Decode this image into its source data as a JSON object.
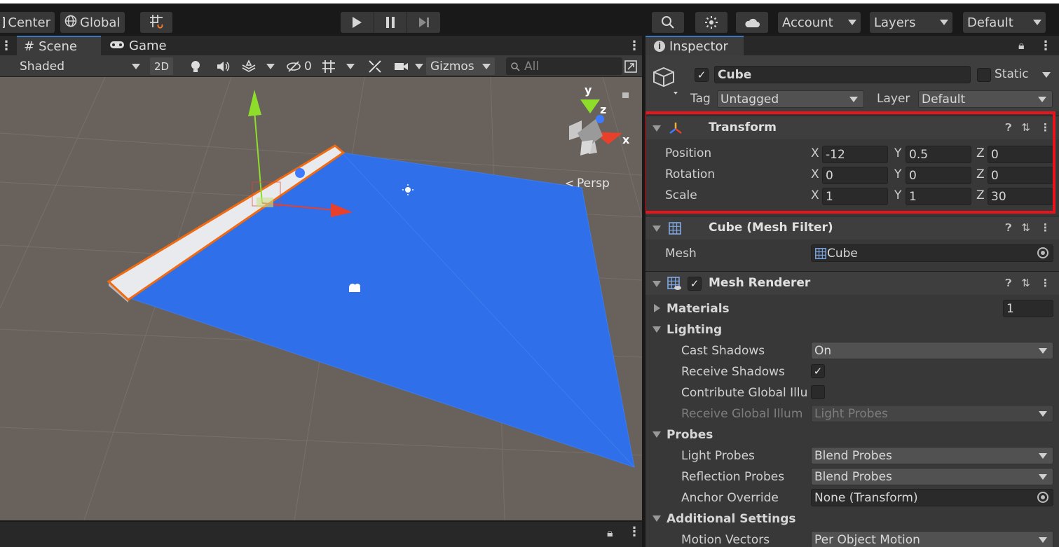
{
  "toolbar": {
    "pivot_label": "Center",
    "space_label": "Global",
    "account_label": "Account",
    "layers_label": "Layers",
    "layout_label": "Default"
  },
  "scene": {
    "tab_scene": "Scene",
    "tab_game": "Game",
    "shading_mode": "Shaded",
    "mode_2d": "2D",
    "hidden_count": "0",
    "gizmos_label": "Gizmos",
    "search_placeholder": "All",
    "projection_label": "Persp",
    "gizmo_axes": {
      "x": "x",
      "y": "y",
      "z": "z"
    }
  },
  "inspector": {
    "tab_label": "Inspector",
    "object": {
      "name": "Cube",
      "active": true,
      "static_label": "Static",
      "tag_label": "Tag",
      "tag_value": "Untagged",
      "layer_label": "Layer",
      "layer_value": "Default"
    },
    "transform": {
      "title": "Transform",
      "highlight_color": "#e8141c",
      "rows": [
        {
          "label": "Position",
          "x": "-12",
          "y": "0.5",
          "z": "0"
        },
        {
          "label": "Rotation",
          "x": "0",
          "y": "0",
          "z": "0"
        },
        {
          "label": "Scale",
          "x": "1",
          "y": "1",
          "z": "30"
        }
      ],
      "axis_labels": {
        "x": "X",
        "y": "Y",
        "z": "Z"
      }
    },
    "mesh_filter": {
      "title": "Cube (Mesh Filter)",
      "mesh_label": "Mesh",
      "mesh_value": "Cube"
    },
    "mesh_renderer": {
      "title": "Mesh Renderer",
      "enabled": true,
      "materials_label": "Materials",
      "materials_count": "1",
      "lighting_label": "Lighting",
      "cast_shadows_label": "Cast Shadows",
      "cast_shadows_value": "On",
      "receive_shadows_label": "Receive Shadows",
      "receive_shadows": true,
      "contribute_gi_label": "Contribute Global Illu",
      "receive_gi_label": "Receive Global Illum",
      "receive_gi_value": "Light Probes",
      "probes_label": "Probes",
      "light_probes_label": "Light Probes",
      "light_probes_value": "Blend Probes",
      "reflection_probes_label": "Reflection Probes",
      "reflection_probes_value": "Blend Probes",
      "anchor_override_label": "Anchor Override",
      "anchor_override_value": "None (Transform)",
      "additional_label": "Additional Settings",
      "motion_vectors_label": "Motion Vectors",
      "motion_vectors_value": "Per Object Motion"
    }
  },
  "colors": {
    "plane_blue": "#2f6fe9",
    "ground": "#69625c",
    "selection_orange": "#f06a12",
    "axis_x": "#e8402a",
    "axis_y": "#8edd2b",
    "axis_z": "#3e7bff"
  }
}
